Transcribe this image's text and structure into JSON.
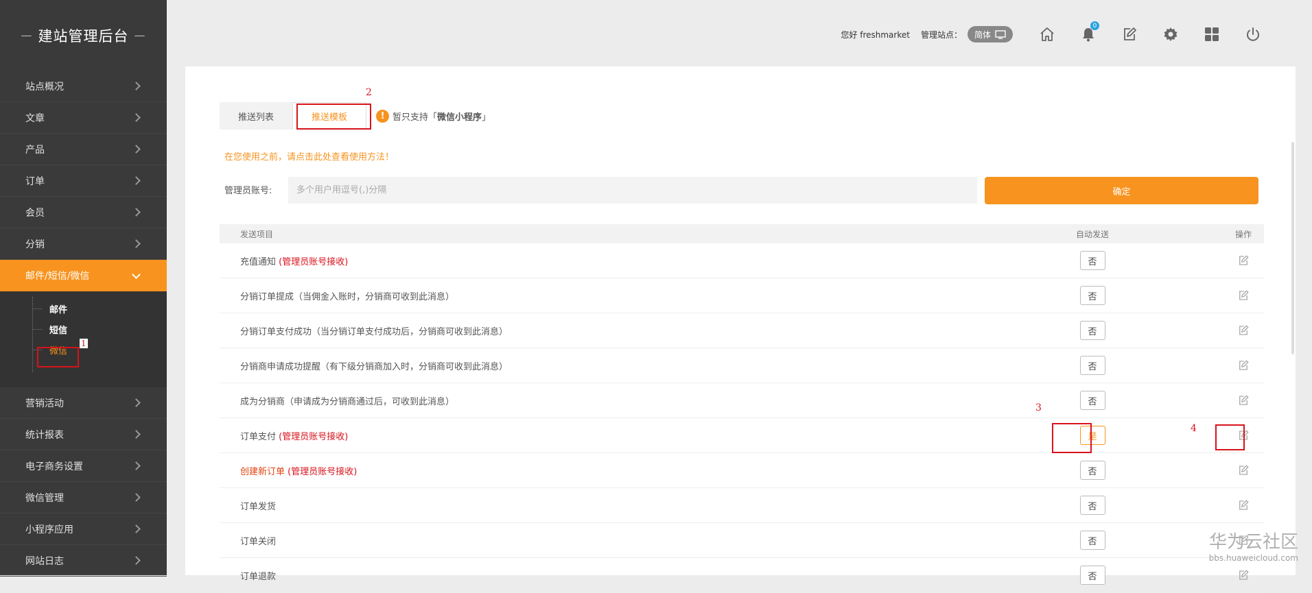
{
  "sidebar": {
    "brand": "建站管理后台",
    "items": [
      {
        "label": "站点概况"
      },
      {
        "label": "文章"
      },
      {
        "label": "产品"
      },
      {
        "label": "订单"
      },
      {
        "label": "会员"
      },
      {
        "label": "分销"
      },
      {
        "label": "邮件/短信/微信",
        "active": true
      },
      {
        "label": "营销活动"
      },
      {
        "label": "统计报表"
      },
      {
        "label": "电子商务设置"
      },
      {
        "label": "微信管理"
      },
      {
        "label": "小程序应用"
      },
      {
        "label": "网站日志"
      }
    ],
    "sub_items": [
      {
        "label": "邮件"
      },
      {
        "label": "短信"
      },
      {
        "label": "微信",
        "current": true
      }
    ]
  },
  "header": {
    "greeting": "您好 freshmarket",
    "site_label": "管理站点：",
    "language": "简体",
    "notification_count": "0",
    "icons": [
      "home-icon",
      "bell-icon",
      "edit-icon",
      "gear-icon",
      "grid-icon",
      "power-icon"
    ]
  },
  "tabs": [
    {
      "label": "推送列表"
    },
    {
      "label": "推送模板",
      "active": true
    }
  ],
  "notice": {
    "prefix": "暂只支持「",
    "highlight": "微信小程序",
    "suffix": "」"
  },
  "usage_link": "在您使用之前，请点击此处查看使用方法！",
  "account": {
    "label": "管理员账号:",
    "placeholder": "多个用户用逗号(,)分隔",
    "value": ""
  },
  "confirm_label": "确定",
  "table": {
    "headers": {
      "item": "发送项目",
      "auto": "自动发送",
      "op": "操作"
    },
    "rows": [
      {
        "name": "充值通知 ",
        "tag": "(管理员账号接收)",
        "auto": "否"
      },
      {
        "name": "分销订单提成（当佣金入账时，分销商可收到此消息）",
        "tag": "",
        "auto": "否"
      },
      {
        "name": "分销订单支付成功（当分销订单支付成功后，分销商可收到此消息）",
        "tag": "",
        "auto": "否"
      },
      {
        "name": "分销商申请成功提醒（有下级分销商加入时，分销商可收到此消息）",
        "tag": "",
        "auto": "否"
      },
      {
        "name": "成为分销商（申请成为分销商通过后，可收到此消息）",
        "tag": "",
        "auto": "否"
      },
      {
        "name": "订单支付 ",
        "tag": "(管理员账号接收)",
        "auto": "是"
      },
      {
        "name": "创建新订单 ",
        "tag": "(管理员账号接收)",
        "auto": "否",
        "orange": true
      },
      {
        "name": "订单发货",
        "tag": "",
        "auto": "否"
      },
      {
        "name": "订单关闭",
        "tag": "",
        "auto": "否"
      },
      {
        "name": "订单退款",
        "tag": "",
        "auto": "否"
      }
    ]
  },
  "annotations": [
    "1",
    "2",
    "3",
    "4"
  ],
  "watermark": {
    "line1": "华为云社区",
    "line2": "bbs.huaweicloud.com"
  },
  "colors": {
    "accent": "#f7931e",
    "sidebar": "#3a3a3a",
    "highlight_red": "#d8121b"
  }
}
